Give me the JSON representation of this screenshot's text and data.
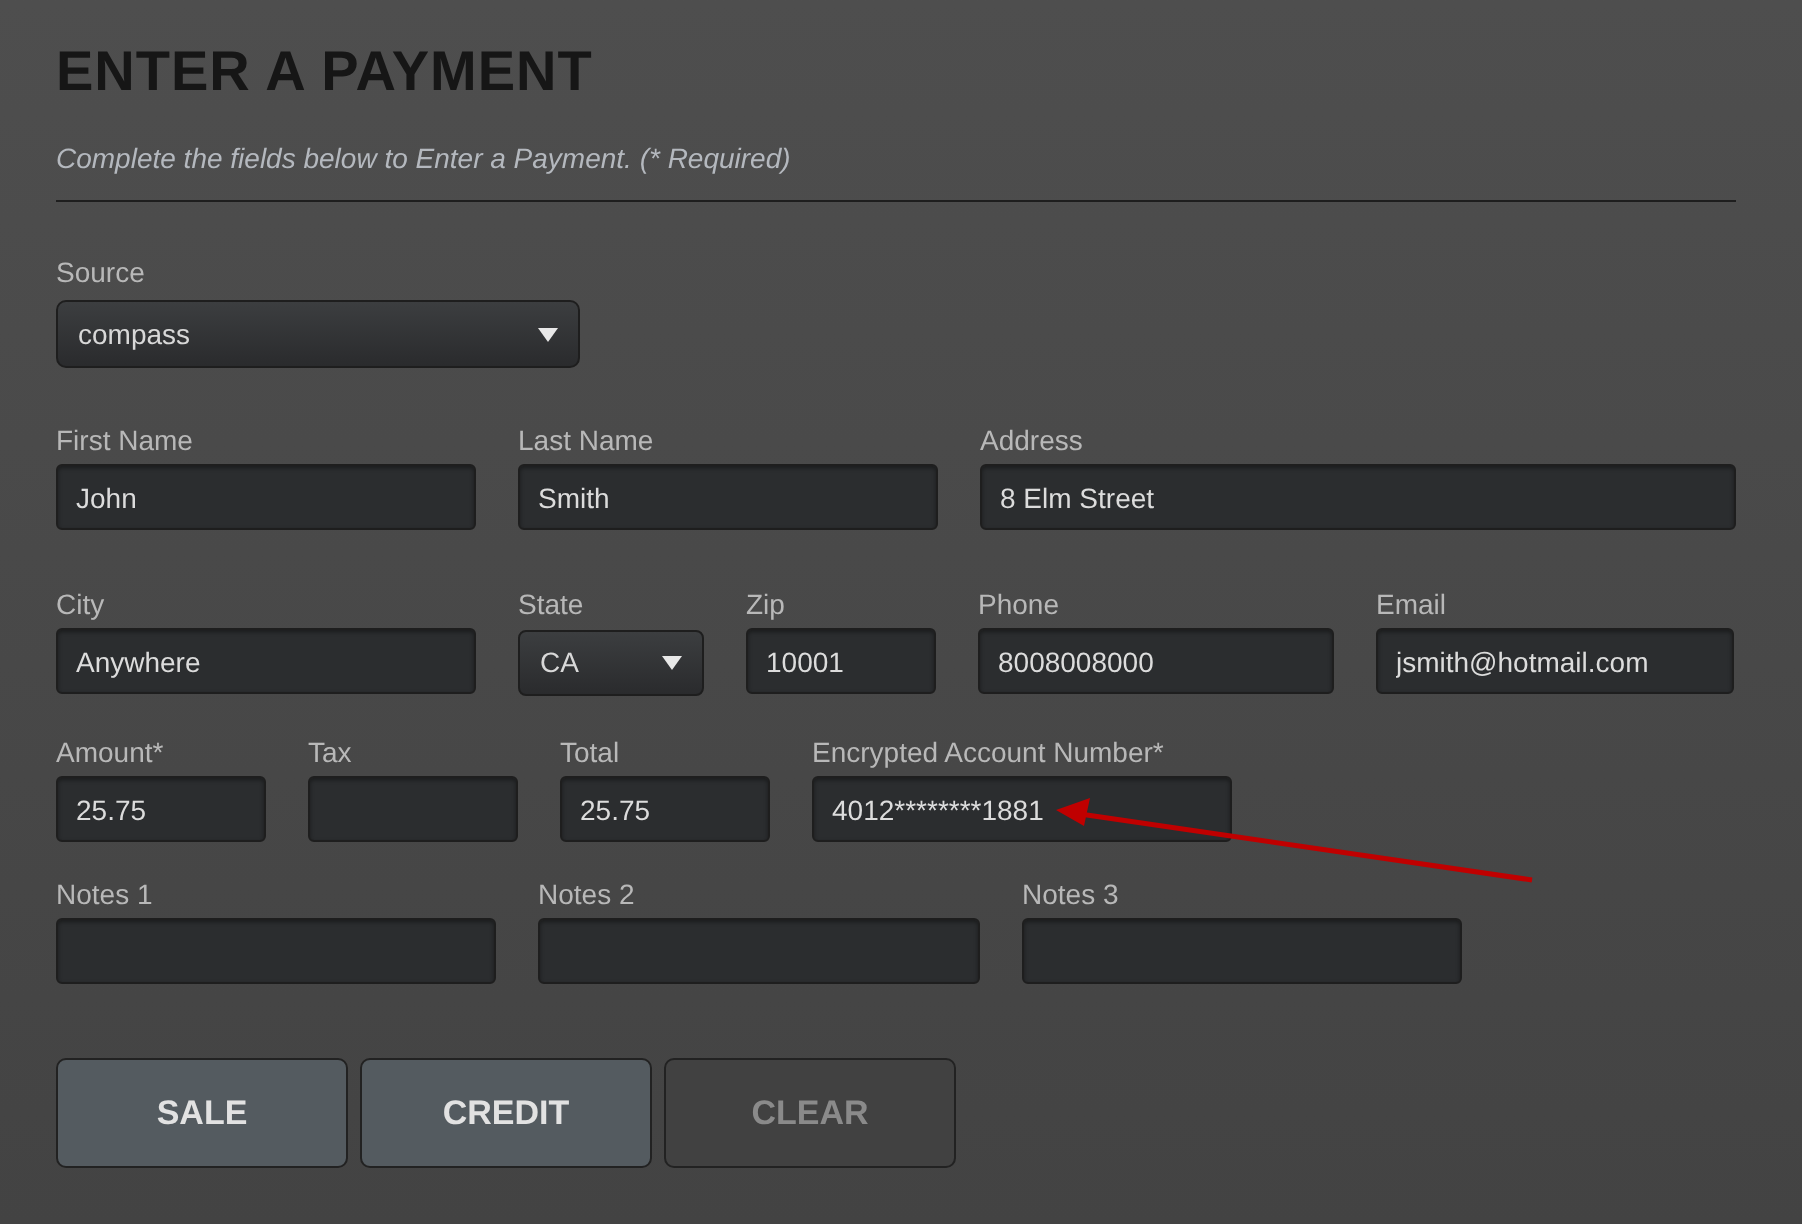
{
  "title": "ENTER A PAYMENT",
  "subtitle": "Complete the fields below to Enter a Payment. (* Required)",
  "source": {
    "label": "Source",
    "value": "compass"
  },
  "rows": [
    [
      {
        "label": "First Name",
        "value": "John",
        "kind": "text"
      },
      {
        "label": "Last Name",
        "value": "Smith",
        "kind": "text"
      },
      {
        "label": "Address",
        "value": "8 Elm Street",
        "kind": "text"
      }
    ],
    [
      {
        "label": "City",
        "value": "Anywhere",
        "kind": "text"
      },
      {
        "label": "State",
        "value": "CA",
        "kind": "select"
      },
      {
        "label": "Zip",
        "value": "10001",
        "kind": "text"
      },
      {
        "label": "Phone",
        "value": "8008008000",
        "kind": "text"
      },
      {
        "label": "Email",
        "value": "jsmith@hotmail.com",
        "kind": "text"
      }
    ],
    [
      {
        "label": "Amount*",
        "value": "25.75",
        "kind": "text"
      },
      {
        "label": "Tax",
        "kind": "text"
      },
      {
        "label": "Total",
        "value": "25.75",
        "kind": "text"
      },
      {
        "label": "Encrypted Account Number*",
        "value": "4012********1881",
        "kind": "text"
      }
    ],
    [
      {
        "label": "Notes 1",
        "kind": "text"
      },
      {
        "label": "Notes 2",
        "kind": "text"
      },
      {
        "label": "Notes 3",
        "kind": "text"
      }
    ]
  ],
  "buttons": [
    {
      "label": "SALE",
      "disabled": false
    },
    {
      "label": "CREDIT",
      "disabled": false
    },
    {
      "label": "CLEAR",
      "disabled": true
    }
  ]
}
